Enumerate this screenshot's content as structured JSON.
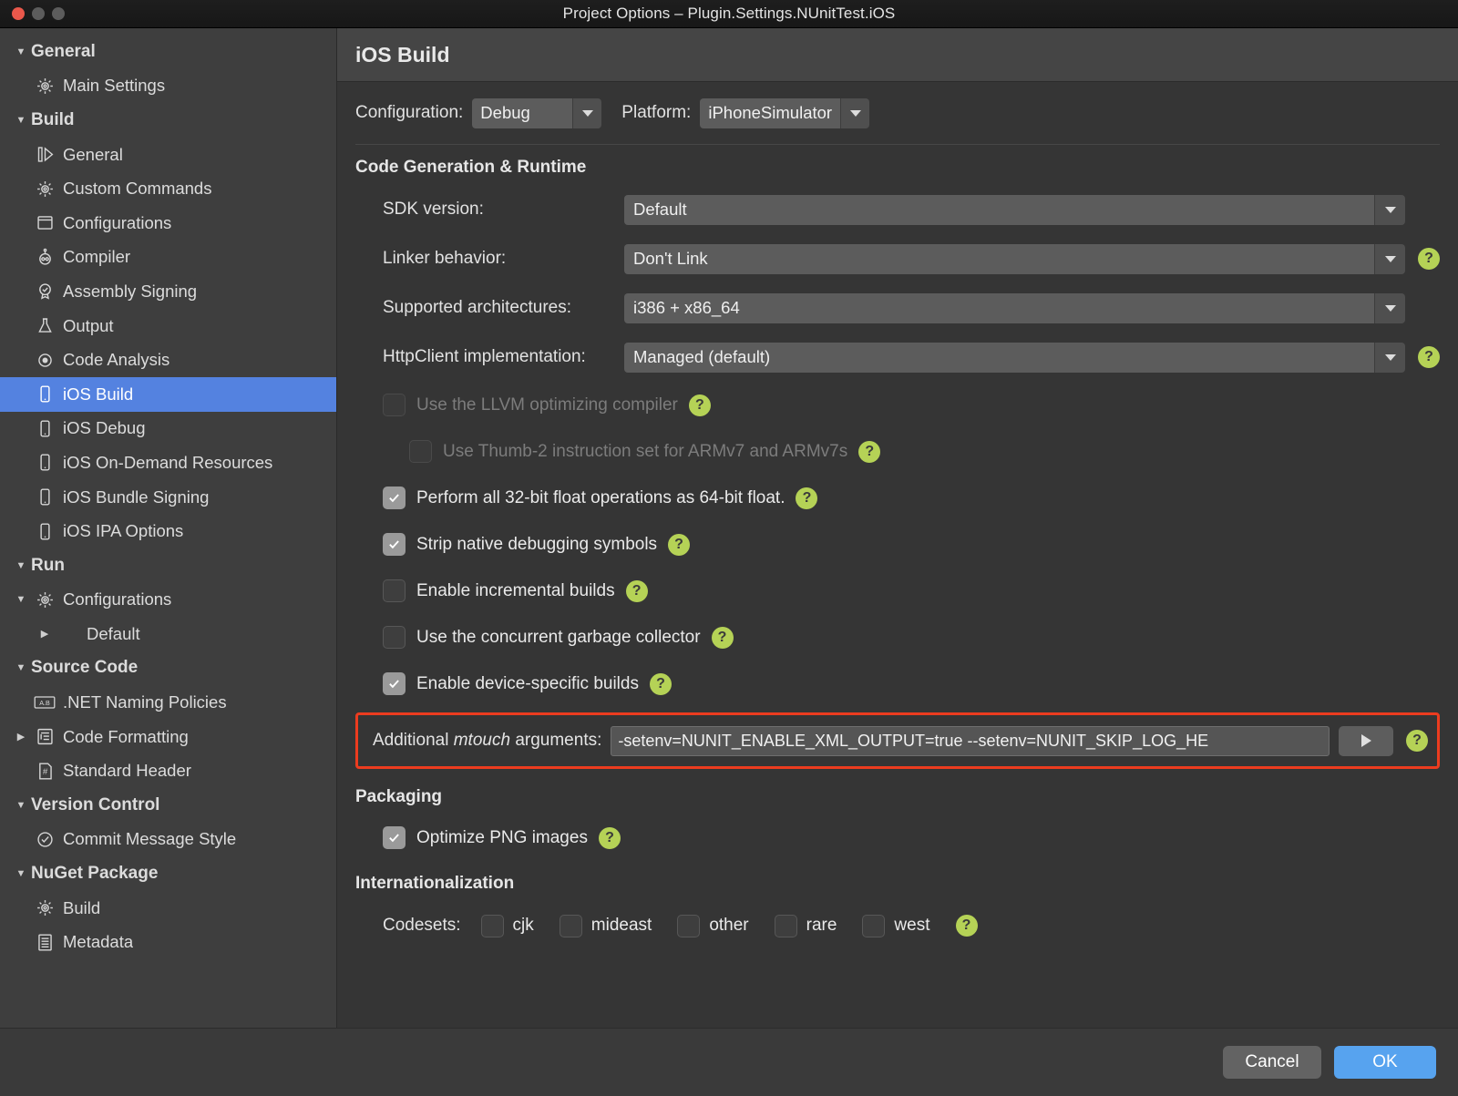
{
  "window": {
    "title": "Project Options – Plugin.Settings.NUnitTest.iOS",
    "traffic_lights": [
      "close-red",
      "minimize-grey",
      "zoom-grey"
    ]
  },
  "sidebar": {
    "items": [
      {
        "label": "General",
        "kind": "group",
        "icon": "disclosure-down-icon",
        "expanded": true,
        "level": 0
      },
      {
        "label": "Main Settings",
        "kind": "leaf",
        "icon": "gear-icon",
        "level": 1
      },
      {
        "label": "Build",
        "kind": "group",
        "icon": "disclosure-down-icon",
        "expanded": true,
        "level": 0
      },
      {
        "label": "General",
        "kind": "leaf",
        "icon": "page-play-icon",
        "level": 1
      },
      {
        "label": "Custom Commands",
        "kind": "leaf",
        "icon": "gear-icon",
        "level": 1
      },
      {
        "label": "Configurations",
        "kind": "leaf",
        "icon": "window-icon",
        "level": 1
      },
      {
        "label": "Compiler",
        "kind": "leaf",
        "icon": "robot-icon",
        "level": 1
      },
      {
        "label": "Assembly Signing",
        "kind": "leaf",
        "icon": "seal-check-icon",
        "level": 1
      },
      {
        "label": "Output",
        "kind": "leaf",
        "icon": "flask-icon",
        "level": 1
      },
      {
        "label": "Code Analysis",
        "kind": "leaf",
        "icon": "radio-dot-icon",
        "level": 1
      },
      {
        "label": "iOS Build",
        "kind": "leaf",
        "icon": "phone-icon",
        "level": 1,
        "selected": true
      },
      {
        "label": "iOS Debug",
        "kind": "leaf",
        "icon": "phone-icon",
        "level": 1
      },
      {
        "label": "iOS On-Demand Resources",
        "kind": "leaf",
        "icon": "phone-icon",
        "level": 1
      },
      {
        "label": "iOS Bundle Signing",
        "kind": "leaf",
        "icon": "phone-icon",
        "level": 1
      },
      {
        "label": "iOS IPA Options",
        "kind": "leaf",
        "icon": "phone-icon",
        "level": 1
      },
      {
        "label": "Run",
        "kind": "group",
        "icon": "disclosure-down-icon",
        "expanded": true,
        "level": 0
      },
      {
        "label": "Configurations",
        "kind": "leaf",
        "icon": "gear-icon",
        "level": 1,
        "twisty": "down"
      },
      {
        "label": "Default",
        "kind": "leaf",
        "icon": "none",
        "level": 2,
        "twisty": "right"
      },
      {
        "label": "Source Code",
        "kind": "group",
        "icon": "disclosure-down-icon",
        "expanded": true,
        "level": 0
      },
      {
        "label": ".NET Naming Policies",
        "kind": "leaf",
        "icon": "ab-icon",
        "level": 1
      },
      {
        "label": "Code Formatting",
        "kind": "leaf",
        "icon": "format-list-icon",
        "level": 1,
        "twisty": "right"
      },
      {
        "label": "Standard Header",
        "kind": "leaf",
        "icon": "hash-doc-icon",
        "level": 1
      },
      {
        "label": "Version Control",
        "kind": "group",
        "icon": "disclosure-down-icon",
        "expanded": true,
        "level": 0
      },
      {
        "label": "Commit Message Style",
        "kind": "leaf",
        "icon": "check-circle-icon",
        "level": 1
      },
      {
        "label": "NuGet Package",
        "kind": "group",
        "icon": "disclosure-down-icon",
        "expanded": true,
        "level": 0
      },
      {
        "label": "Build",
        "kind": "leaf",
        "icon": "gear-icon",
        "level": 1
      },
      {
        "label": "Metadata",
        "kind": "leaf",
        "icon": "lines-doc-icon",
        "level": 1
      }
    ]
  },
  "main": {
    "page_title": "iOS Build",
    "config_bar": {
      "configuration_label": "Configuration:",
      "configuration_value": "Debug",
      "platform_label": "Platform:",
      "platform_value": "iPhoneSimulator"
    },
    "sections": {
      "code_generation": {
        "title": "Code Generation & Runtime",
        "fields": [
          {
            "label": "SDK version:",
            "value": "Default",
            "has_help": false
          },
          {
            "label": "Linker behavior:",
            "value": "Don't Link",
            "has_help": true
          },
          {
            "label": "Supported architectures:",
            "value": "i386 + x86_64",
            "has_help": false
          },
          {
            "label": "HttpClient implementation:",
            "value": "Managed (default)",
            "has_help": true
          }
        ],
        "checkboxes": [
          {
            "label": "Use the LLVM optimizing compiler",
            "checked": false,
            "disabled": true,
            "indent": 0
          },
          {
            "label": "Use Thumb-2 instruction set for ARMv7 and ARMv7s",
            "checked": false,
            "disabled": true,
            "indent": 1
          },
          {
            "label": "Perform all 32-bit float operations as 64-bit float.",
            "checked": true,
            "disabled": false,
            "indent": 0
          },
          {
            "label": "Strip native debugging symbols",
            "checked": true,
            "disabled": false,
            "indent": 0
          },
          {
            "label": "Enable incremental builds",
            "checked": false,
            "disabled": false,
            "indent": 0
          },
          {
            "label": "Use the concurrent garbage collector",
            "checked": false,
            "disabled": false,
            "indent": 0
          },
          {
            "label": "Enable device-specific builds",
            "checked": true,
            "disabled": false,
            "indent": 0
          }
        ]
      },
      "mtouch": {
        "label_prefix": "Additional ",
        "label_italic": "mtouch",
        "label_suffix": " arguments:",
        "value": "-setenv=NUNIT_ENABLE_XML_OUTPUT=true --setenv=NUNIT_SKIP_LOG_HE",
        "expand_button": "expand-icon",
        "highlight_color": "#ec3c1f"
      },
      "packaging": {
        "title": "Packaging",
        "checkboxes": [
          {
            "label": "Optimize PNG images",
            "checked": true,
            "disabled": false,
            "indent": 0
          }
        ]
      },
      "internationalization": {
        "title": "Internationalization",
        "codesets_label": "Codesets:",
        "codesets": [
          {
            "label": "cjk",
            "checked": false
          },
          {
            "label": "mideast",
            "checked": false
          },
          {
            "label": "other",
            "checked": false
          },
          {
            "label": "rare",
            "checked": false
          },
          {
            "label": "west",
            "checked": false
          }
        ]
      }
    },
    "help_glyph": "?"
  },
  "footer": {
    "cancel_label": "Cancel",
    "ok_label": "OK"
  },
  "colors": {
    "accent_selection": "#5482e0",
    "accent_ok": "#57a3ef",
    "help_badge": "#b5d256",
    "highlight": "#ec3c1f"
  }
}
